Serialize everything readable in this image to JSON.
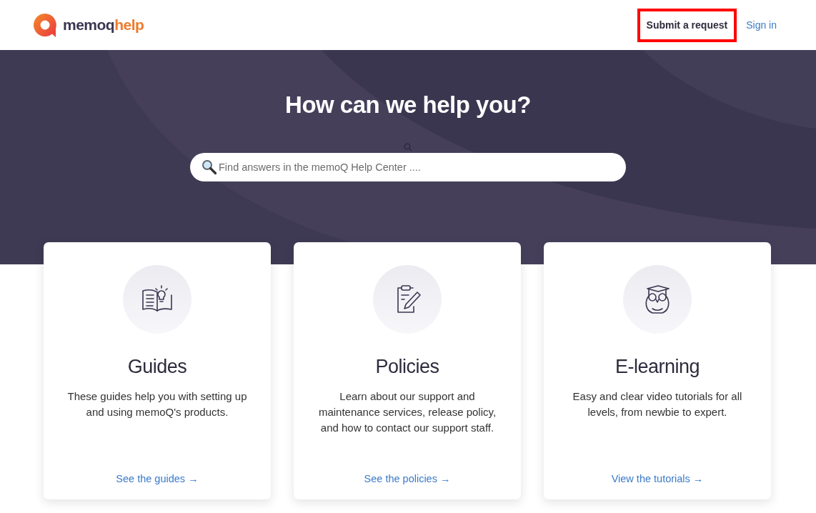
{
  "header": {
    "logo": {
      "brand": "memoq",
      "suffix": "help"
    },
    "links": [
      {
        "label": "Submit a request",
        "kind": "request",
        "highlighted": true
      },
      {
        "label": "Sign in",
        "kind": "signin",
        "highlighted": false
      }
    ]
  },
  "hero": {
    "title": "How can we help you?",
    "search": {
      "placeholder": "Find answers in the memoQ Help Center ...."
    }
  },
  "cards": [
    {
      "kind": "guides",
      "title": "Guides",
      "text": "These guides help you with setting up and using memoQ's products.",
      "link": "See the guides",
      "arrow": "→"
    },
    {
      "kind": "policies",
      "title": "Policies",
      "text": "Learn about our support and maintenance services, release policy, and how to contact our support staff.",
      "link": "See the policies",
      "arrow": "→"
    },
    {
      "kind": "elearning",
      "title": "E-learning",
      "text": "Easy and clear video tutorials for all levels, from newbie to expert.",
      "link": "View the tutorials",
      "arrow": "→"
    }
  ]
}
